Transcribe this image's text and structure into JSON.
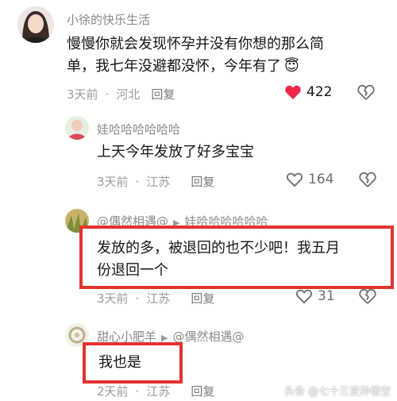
{
  "colors": {
    "accent_red": "#e3332f",
    "like_red": "#f0284a",
    "muted": "#9b9b9b"
  },
  "comment1": {
    "username": "小徐的快乐生活",
    "text_line1": "慢慢你就会发现怀孕并没有你想的那么简",
    "text_line2": "单，我七年没避都没怀，今年有了",
    "emoji": "😇",
    "time": "3天前",
    "location": "河北",
    "reply": "回复",
    "likes": "422",
    "icons": [
      "heart-filled-icon",
      "broken-heart-icon"
    ]
  },
  "reply1": {
    "username": "娃哈哈哈哈哈哈",
    "text": "上天今年发放了好多宝宝",
    "time": "3天前",
    "location": "江苏",
    "reply": "回复",
    "likes": "164"
  },
  "reply2": {
    "username": "@偶然相遇@",
    "reply_to": "娃哈哈哈哈哈哈",
    "text_line1": "发放的多，被退回的也不少吧！我五月",
    "text_line2": "份退回一个",
    "time": "3天前",
    "location": "江苏",
    "reply": "回复",
    "likes": "31"
  },
  "reply3": {
    "username": "甜心小肥羊",
    "reply_to": "@偶然相遇@",
    "text": "我也是",
    "time": "2天前",
    "location": "江苏",
    "reply": "回复"
  },
  "watermark": "头条 @七十三变孙悟空"
}
